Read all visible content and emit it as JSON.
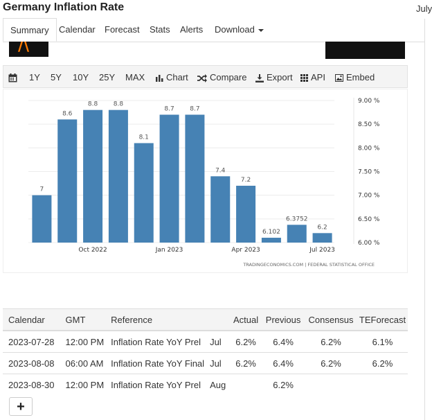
{
  "header": {
    "title": "Germany Inflation Rate",
    "date_partial": "July"
  },
  "tabs": [
    "Summary",
    "Calendar",
    "Forecast",
    "Stats",
    "Alerts",
    "Download"
  ],
  "toolbar": {
    "ranges": [
      "1Y",
      "5Y",
      "10Y",
      "25Y",
      "MAX"
    ],
    "chart_label": "Chart",
    "compare_label": "Compare",
    "export_label": "Export",
    "api_label": "API",
    "embed_label": "Embed"
  },
  "chart_data": {
    "type": "bar",
    "color": "#4682b4",
    "values": [
      7,
      8.6,
      8.8,
      8.8,
      8.1,
      8.7,
      8.7,
      7.4,
      7.2,
      6.102,
      6.3752,
      6.2
    ],
    "data_labels": [
      "7",
      "8.6",
      "8.8",
      "8.8",
      "8.1",
      "8.7",
      "8.7",
      "7.4",
      "7.2",
      "6.102",
      "6.3752",
      "6.2"
    ],
    "x_ticks": [
      {
        "label": "Oct 2022",
        "index": 2
      },
      {
        "label": "Jan 2023",
        "index": 5
      },
      {
        "label": "Apr 2023",
        "index": 8
      },
      {
        "label": "Jul 2023",
        "index": 11
      }
    ],
    "y_ticks": [
      "9.00 %",
      "8.50 %",
      "8.00 %",
      "7.50 %",
      "7.00 %",
      "6.50 %",
      "6.00 %"
    ],
    "y_tick_values": [
      9,
      8.5,
      8,
      7.5,
      7,
      6.5,
      6
    ],
    "ylim": [
      6,
      9
    ],
    "source": "TRADINGECONOMICS.COM | FEDERAL STATISTICAL OFFICE",
    "grid": true
  },
  "calendar": {
    "headers": [
      "Calendar",
      "GMT",
      "Reference",
      "",
      "Actual",
      "Previous",
      "Consensus",
      "TEForecast"
    ],
    "rows": [
      [
        "2023-07-28",
        "12:00 PM",
        "Inflation Rate YoY Prel",
        "Jul",
        "6.2%",
        "6.4%",
        "6.2%",
        "6.1%"
      ],
      [
        "2023-08-08",
        "06:00 AM",
        "Inflation Rate YoY Final",
        "Jul",
        "6.2%",
        "6.4%",
        "6.2%",
        "6.2%"
      ],
      [
        "2023-08-30",
        "12:00 PM",
        "Inflation Rate YoY Prel",
        "Aug",
        "",
        "6.2%",
        "",
        ""
      ]
    ],
    "add_label": "+"
  }
}
